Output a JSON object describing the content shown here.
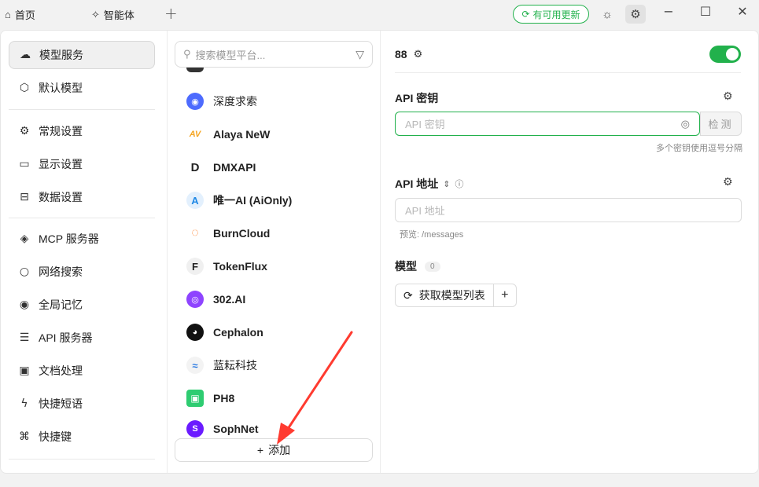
{
  "titlebar": {
    "tabs": [
      {
        "icon": "home-icon",
        "glyph": "⌂",
        "label": "首页"
      },
      {
        "icon": "sparkle-icon",
        "glyph": "✧",
        "label": "智能体"
      }
    ],
    "plus": "+",
    "update_label": "有可用更新",
    "window_controls": {
      "minimize": "−",
      "maximize": "☐",
      "close": "✕"
    }
  },
  "sidebar": {
    "items": [
      {
        "icon": "cloud-icon",
        "glyph": "☁",
        "label": "模型服务",
        "active": true
      },
      {
        "icon": "cube-icon",
        "glyph": "⬡",
        "label": "默认模型"
      },
      {
        "icon": "sliders-icon",
        "glyph": "⚙",
        "label": "常规设置"
      },
      {
        "icon": "monitor-icon",
        "glyph": "▭",
        "label": "显示设置"
      },
      {
        "icon": "drive-icon",
        "glyph": "⊟",
        "label": "数据设置"
      },
      {
        "icon": "mcp-icon",
        "glyph": "◈",
        "label": "MCP 服务器"
      },
      {
        "icon": "search-icon",
        "glyph": "○",
        "label": "网络搜索"
      },
      {
        "icon": "brain-icon",
        "glyph": "◉",
        "label": "全局记忆"
      },
      {
        "icon": "server-icon",
        "glyph": "☰",
        "label": "API 服务器"
      },
      {
        "icon": "document-icon",
        "glyph": "▣",
        "label": "文档处理"
      },
      {
        "icon": "bolt-icon",
        "glyph": "ϟ",
        "label": "快捷短语"
      },
      {
        "icon": "command-icon",
        "glyph": "⌘",
        "label": "快捷键"
      }
    ]
  },
  "providers": {
    "search_placeholder": "搜索模型平台...",
    "items": [
      {
        "label": "深度求索",
        "logo_text": "◉",
        "color": "#4d6bfe"
      },
      {
        "label": "Alaya NeW",
        "logo_text": "AV",
        "color": "#f5a623"
      },
      {
        "label": "DMXAPI",
        "logo_text": "D",
        "color": "#ffffff"
      },
      {
        "label": "唯一AI (AiOnly)",
        "logo_text": "A",
        "color": "#1e88e5"
      },
      {
        "label": "BurnCloud",
        "logo_text": "◌",
        "color": "#ff8a3d"
      },
      {
        "label": "TokenFlux",
        "logo_text": "F",
        "color": "#ffffff"
      },
      {
        "label": "302.AI",
        "logo_text": "◎",
        "color": "#8e44ff"
      },
      {
        "label": "Cephalon",
        "logo_text": "◕",
        "color": "#111111"
      },
      {
        "label": "蓝耘科技",
        "logo_text": "≈",
        "color": "#ffffff"
      },
      {
        "label": "PH8",
        "logo_text": "▣",
        "color": "#2ecc71"
      },
      {
        "label": "SophNet",
        "logo_text": "S",
        "color": "#6a1bff"
      }
    ],
    "add_label": "添加"
  },
  "detail": {
    "title": "88",
    "enabled": true,
    "api_key": {
      "label": "API 密钥",
      "placeholder": "API 密钥",
      "check_label": "检测",
      "hint": "多个密钥使用逗号分隔"
    },
    "api_url": {
      "label": "API 地址",
      "placeholder": "API 地址",
      "preview": "预览: /messages"
    },
    "models": {
      "label": "模型",
      "count": "0",
      "fetch_label": "获取模型列表",
      "add": "+"
    }
  },
  "colors": {
    "accent": "#22b14c"
  }
}
